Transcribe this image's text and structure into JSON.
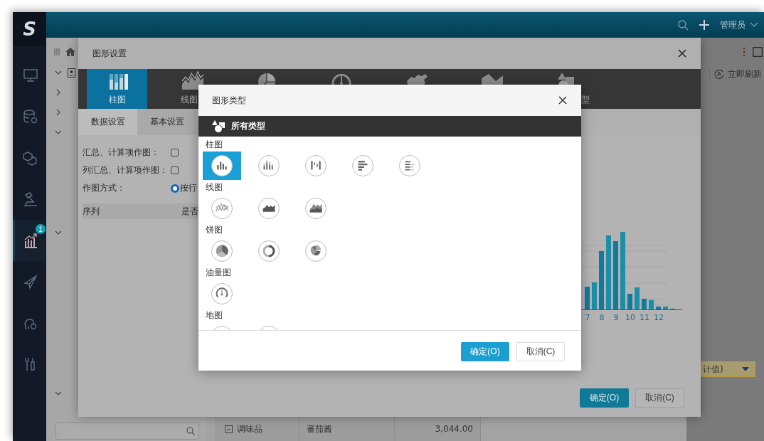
{
  "logo": "S",
  "sidebar": {
    "items": [
      {
        "kind": "monitor",
        "selected": false
      },
      {
        "kind": "database",
        "selected": false
      },
      {
        "kind": "cube",
        "selected": false
      },
      {
        "kind": "hammer",
        "selected": false
      },
      {
        "kind": "chart",
        "selected": true,
        "badge": "1"
      },
      {
        "kind": "plane",
        "selected": false
      },
      {
        "kind": "user",
        "selected": false
      },
      {
        "kind": "tools",
        "selected": false
      }
    ]
  },
  "header": {
    "user": "管理员"
  },
  "backdrop": {
    "refresh": "立即刷新",
    "dropdown_value": "计值)",
    "table_row": [
      "调味品",
      "蕃茄酱",
      "3,044.00"
    ]
  },
  "chart_dialog": {
    "title": "图形设置",
    "chart_tabs": [
      {
        "kind": "column",
        "label": "柱图",
        "selected": true
      },
      {
        "kind": "line",
        "label": "线图",
        "selected": false
      },
      {
        "kind": "pie",
        "selected": false
      },
      {
        "kind": "gauge",
        "selected": false
      },
      {
        "kind": "map",
        "selected": false
      },
      {
        "kind": "shape",
        "selected": false
      },
      {
        "kind": "other",
        "label": "型",
        "selected": false
      }
    ],
    "sub_tabs": [
      {
        "label": "数据设置",
        "selected": true
      },
      {
        "label": "基本设置",
        "selected": false
      }
    ],
    "options": [
      {
        "label": "汇总、计算项作图：",
        "checked": false
      },
      {
        "label": "列汇总、计算项作图：",
        "checked": false
      }
    ],
    "mode": {
      "label": "作图方式：",
      "option": "按行",
      "checked": true
    },
    "columns": [
      "序列",
      "是否"
    ],
    "preview_x_labels": [
      "7",
      "8",
      "9",
      "10",
      "11",
      "12"
    ],
    "buttons": [
      {
        "label": "确定(O)",
        "kind": "primary"
      },
      {
        "label": "取消(C)",
        "kind": "secondary"
      }
    ]
  },
  "type_dialog": {
    "title": "图形类型",
    "category": "所有类型",
    "groups": [
      {
        "label": "柱图",
        "items": [
          {
            "kind": "column",
            "selected": true
          },
          {
            "kind": "stacked",
            "selected": false
          },
          {
            "kind": "waterfall",
            "selected": false
          },
          {
            "kind": "bar",
            "selected": false
          },
          {
            "kind": "stackedbar",
            "selected": false
          }
        ]
      },
      {
        "label": "线图",
        "items": [
          {
            "kind": "line",
            "selected": false
          },
          {
            "kind": "area",
            "selected": false
          },
          {
            "kind": "stackedarea",
            "selected": false
          }
        ]
      },
      {
        "label": "饼图",
        "items": [
          {
            "kind": "pie",
            "selected": false
          },
          {
            "kind": "donut",
            "selected": false
          },
          {
            "kind": "rose",
            "selected": false
          }
        ]
      },
      {
        "label": "油量图",
        "items": [
          {
            "kind": "gauge",
            "selected": false
          }
        ]
      },
      {
        "label": "地图",
        "items": [
          {
            "kind": "map",
            "selected": false
          },
          {
            "kind": "map",
            "selected": false
          }
        ]
      }
    ],
    "buttons": [
      {
        "label": "确定(O)",
        "kind": "primary"
      },
      {
        "label": "取消(C)",
        "kind": "secondary"
      }
    ]
  }
}
